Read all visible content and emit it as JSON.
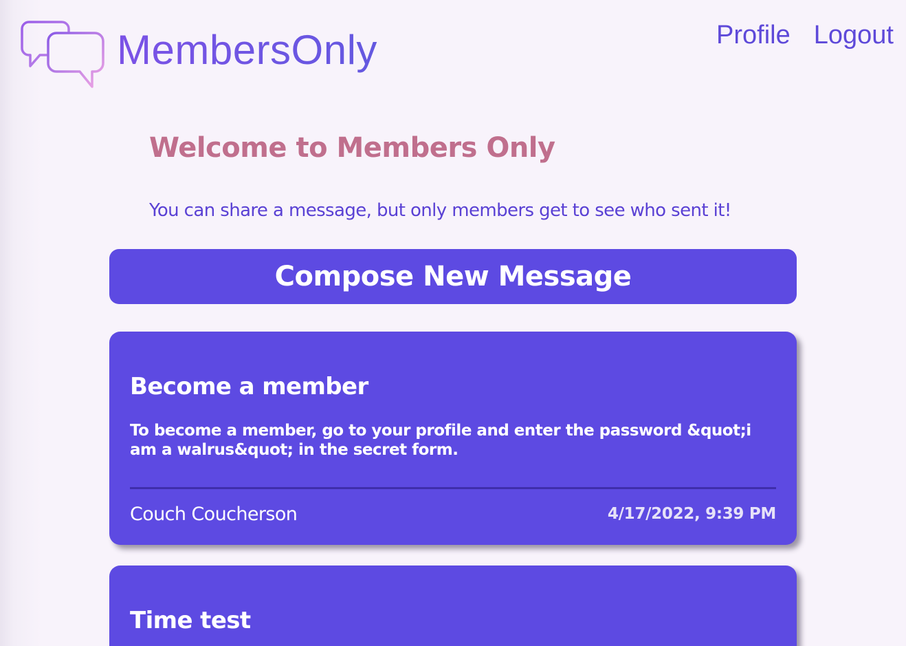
{
  "header": {
    "logo_text": "MembersOnly",
    "nav": {
      "profile_label": "Profile",
      "logout_label": "Logout"
    }
  },
  "main": {
    "welcome_title": "Welcome to Members Only",
    "subtitle": "You can share a message, but only members get to see who sent it!",
    "compose_label": "Compose New Message",
    "messages": [
      {
        "title": "Become a member",
        "body": "To become a member, go to your profile and enter the password &quot;i am a walrus&quot; in the secret form.",
        "author": "Couch Coucherson",
        "timestamp": "4/17/2022, 9:39 PM"
      },
      {
        "title": "Time test"
      }
    ]
  },
  "colors": {
    "accent": "#5d4ae2",
    "welcome": "#c06f8d",
    "subtitle": "#5a41d4",
    "background": "#f8f3fb"
  }
}
